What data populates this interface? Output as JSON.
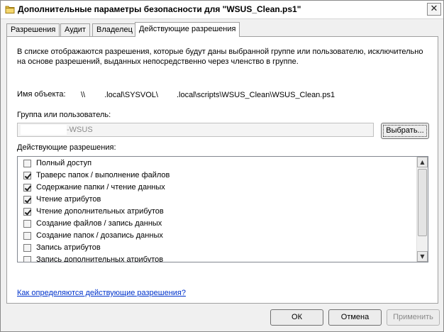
{
  "window": {
    "title": "Дополнительные параметры безопасности  для \"WSUS_Clean.ps1\"",
    "close_glyph": "✕"
  },
  "tabs": [
    {
      "label": "Разрешения"
    },
    {
      "label": "Аудит"
    },
    {
      "label": "Владелец"
    },
    {
      "label": "Действующие разрешения",
      "active": true
    }
  ],
  "description": "В списке отображаются разрешения, которые будут даны выбранной группе или пользователю, исключительно на основе разрешений, выданных непосредственно через членство в группе.",
  "object": {
    "label": "Имя объекта:",
    "path_part1": "\\\\",
    "path_part2": ".local\\SYSVOL\\",
    "path_part3": ".local\\scripts\\WSUS_Clean\\WSUS_Clean.ps1"
  },
  "group": {
    "label": "Группа или пользователь:",
    "value": "-WSUS",
    "choose_button": "Выбрать..."
  },
  "permissions": {
    "label": "Действующие разрешения:",
    "items": [
      {
        "label": "Полный доступ",
        "checked": false
      },
      {
        "label": "Траверс папок / выполнение файлов",
        "checked": true
      },
      {
        "label": "Содержание папки / чтение данных",
        "checked": true
      },
      {
        "label": "Чтение атрибутов",
        "checked": true
      },
      {
        "label": "Чтение дополнительных атрибутов",
        "checked": true
      },
      {
        "label": "Создание файлов / запись данных",
        "checked": false
      },
      {
        "label": "Создание папок / дозапись данных",
        "checked": false
      },
      {
        "label": "Запись атрибутов",
        "checked": false
      },
      {
        "label": "Запись дополнительных атрибутов",
        "checked": false
      }
    ]
  },
  "help_link": "Как определяются действующие разрешения?",
  "buttons": {
    "ok": "ОК",
    "cancel": "Отмена",
    "apply": "Применить"
  }
}
